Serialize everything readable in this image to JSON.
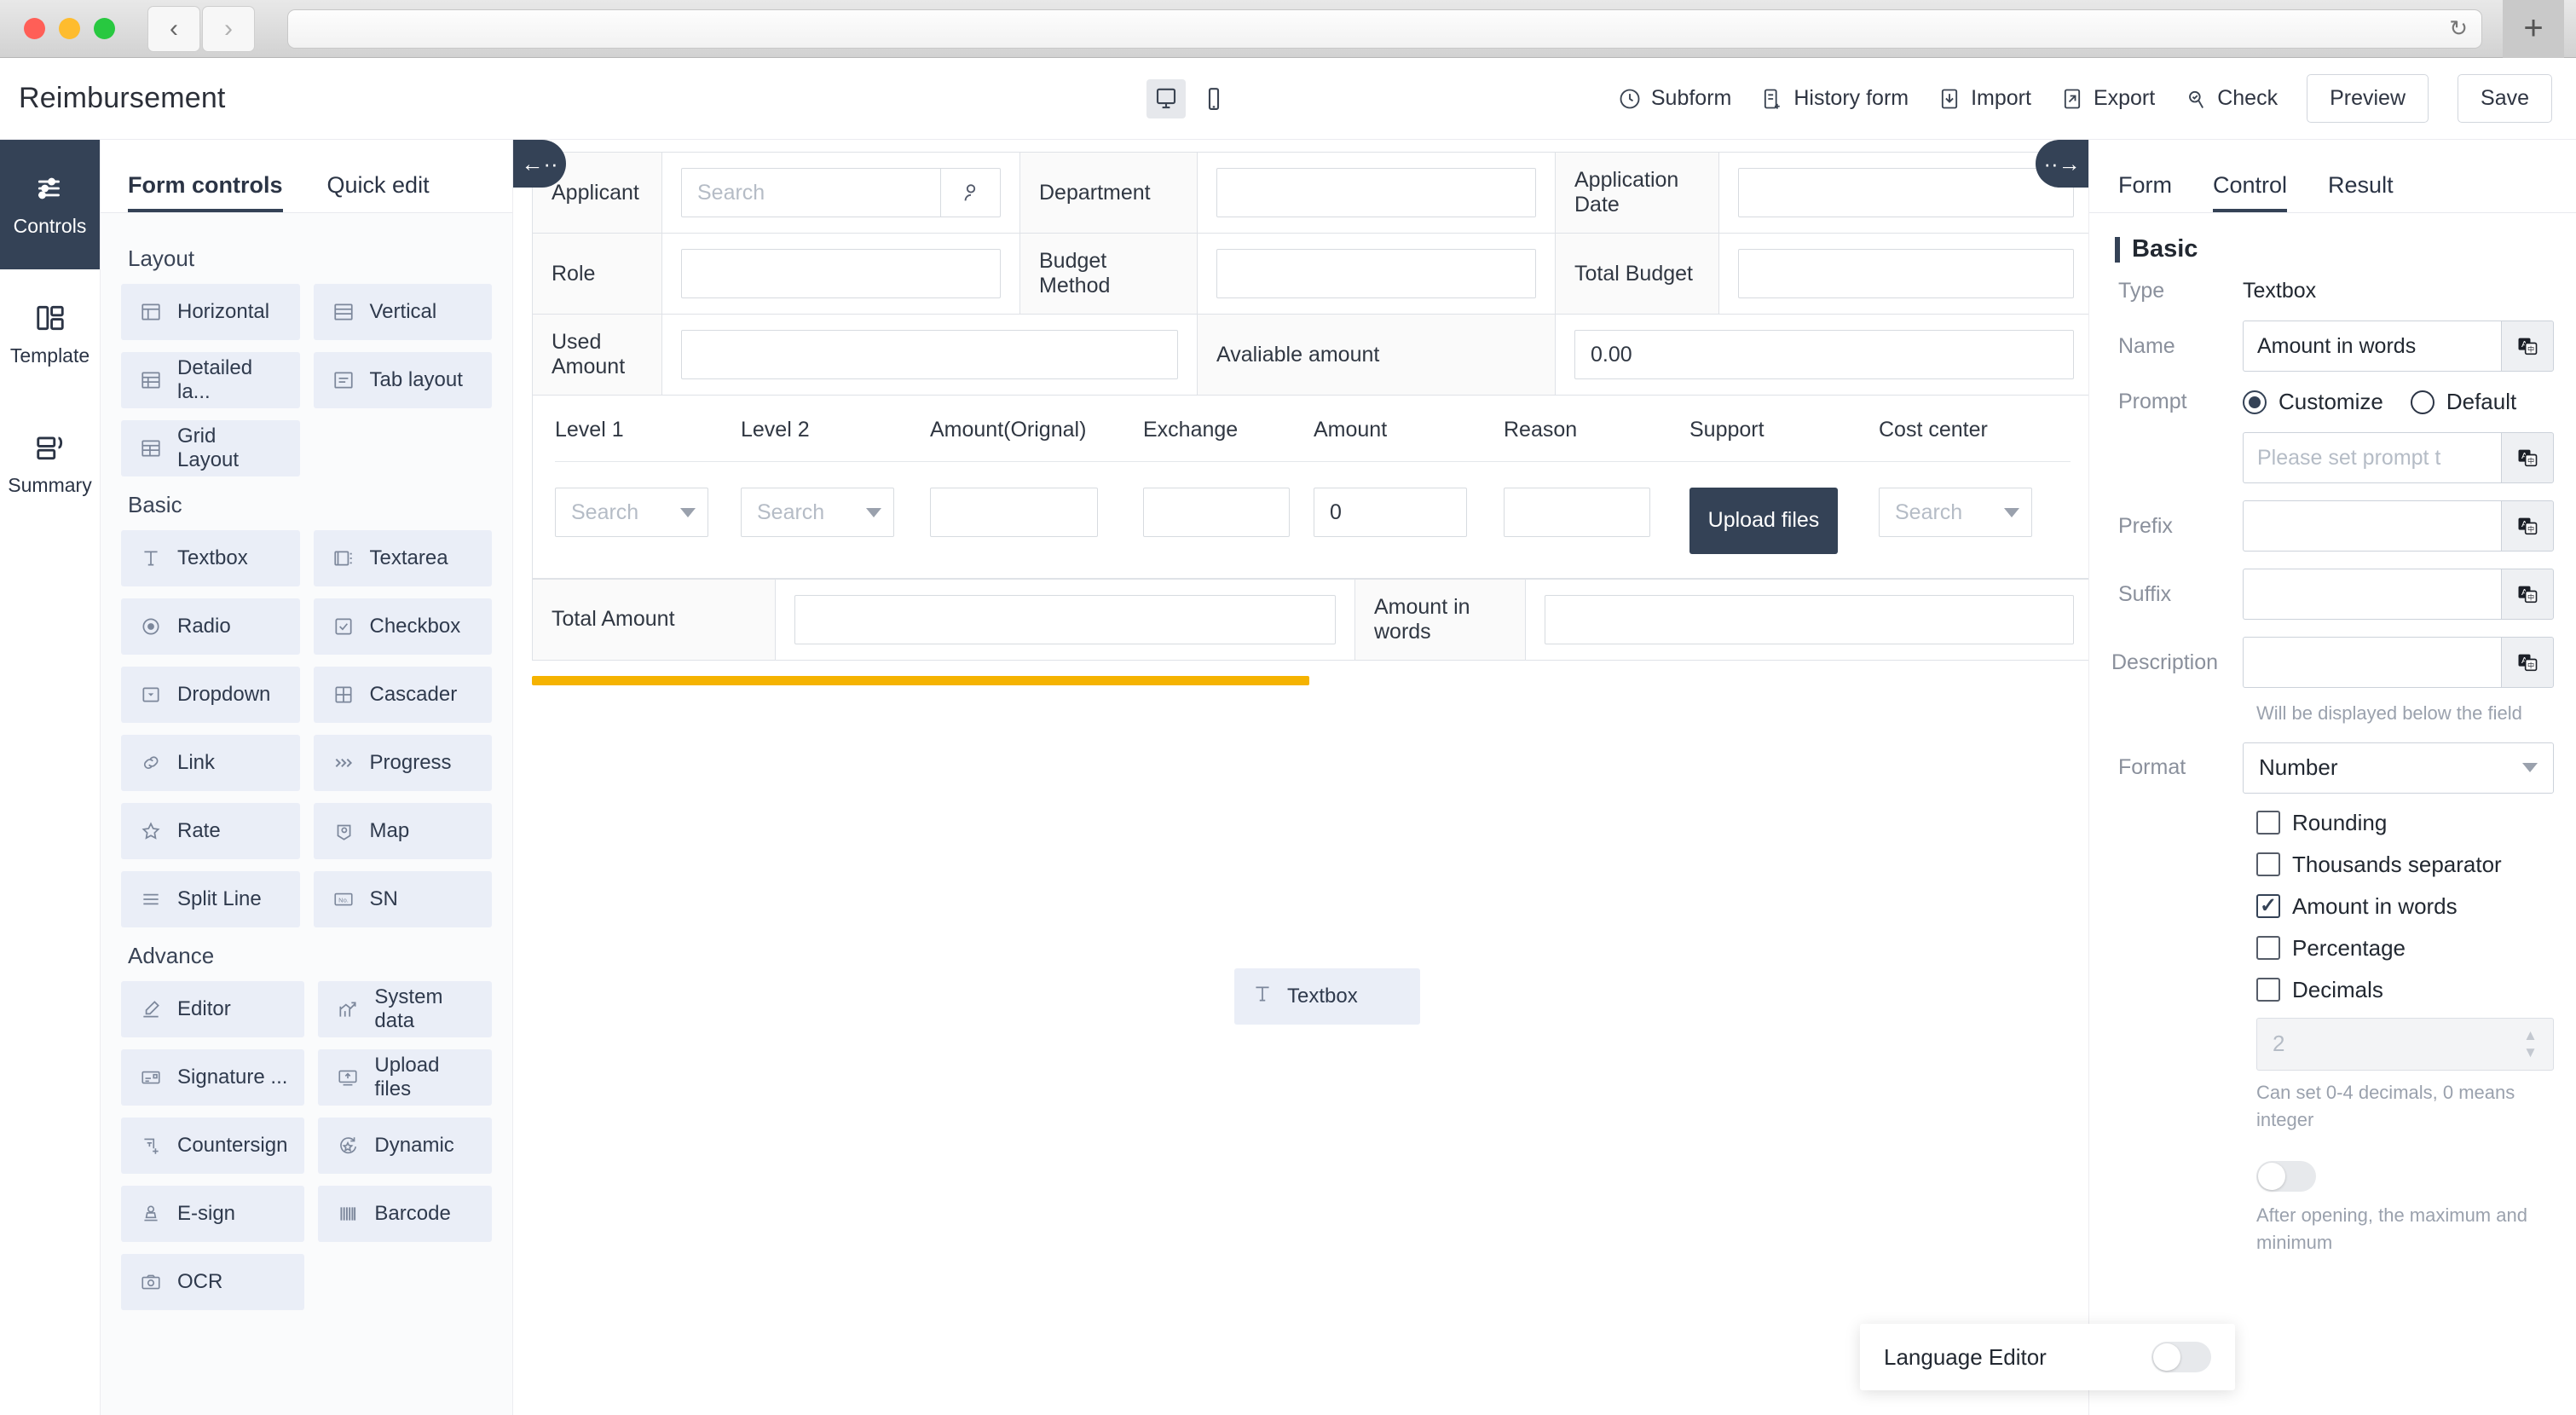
{
  "browser": {
    "back_icon": "chevron-left",
    "forward_icon": "chevron-right",
    "url_value": "",
    "reload_icon": "reload-icon",
    "newtab_label": "+"
  },
  "header": {
    "title": "Reimbursement",
    "device_desktop": "desktop-icon",
    "device_mobile": "mobile-icon",
    "actions": [
      {
        "label": "Subform",
        "icon": "clock-icon"
      },
      {
        "label": "History form",
        "icon": "history-form-icon"
      },
      {
        "label": "Import",
        "icon": "import-icon"
      },
      {
        "label": "Export",
        "icon": "export-icon"
      },
      {
        "label": "Check",
        "icon": "check-search-icon"
      }
    ],
    "preview_label": "Preview",
    "save_label": "Save"
  },
  "rail": {
    "items": [
      {
        "label": "Controls",
        "icon": "sliders-icon",
        "active": true
      },
      {
        "label": "Template",
        "icon": "template-icon",
        "active": false
      },
      {
        "label": "Summary",
        "icon": "summary-icon",
        "active": false
      }
    ]
  },
  "palette": {
    "tabs": [
      {
        "label": "Form controls",
        "active": true
      },
      {
        "label": "Quick edit",
        "active": false
      }
    ],
    "groups": [
      {
        "title": "Layout",
        "items": [
          {
            "label": "Horizontal",
            "icon": "layout-horizontal-icon"
          },
          {
            "label": "Vertical",
            "icon": "layout-vertical-icon"
          },
          {
            "label": "Detailed la...",
            "icon": "layout-detailed-icon"
          },
          {
            "label": "Tab layout",
            "icon": "layout-tab-icon"
          },
          {
            "label": "Grid Layout",
            "icon": "layout-grid-icon"
          }
        ]
      },
      {
        "title": "Basic",
        "items": [
          {
            "label": "Textbox",
            "icon": "textbox-icon"
          },
          {
            "label": "Textarea",
            "icon": "textarea-icon"
          },
          {
            "label": "Radio",
            "icon": "radio-icon"
          },
          {
            "label": "Checkbox",
            "icon": "checkbox-icon"
          },
          {
            "label": "Dropdown",
            "icon": "dropdown-icon"
          },
          {
            "label": "Cascader",
            "icon": "cascader-icon"
          },
          {
            "label": "Link",
            "icon": "link-icon"
          },
          {
            "label": "Progress",
            "icon": "progress-icon"
          },
          {
            "label": "Rate",
            "icon": "star-icon"
          },
          {
            "label": "Map",
            "icon": "map-pin-icon"
          },
          {
            "label": "Split Line",
            "icon": "split-line-icon"
          },
          {
            "label": "SN",
            "icon": "serial-number-icon"
          }
        ]
      },
      {
        "title": "Advance",
        "items": [
          {
            "label": "Editor",
            "icon": "editor-pen-icon"
          },
          {
            "label": "System data",
            "icon": "system-data-chart-icon"
          },
          {
            "label": "Signature ...",
            "icon": "signature-icon"
          },
          {
            "label": "Upload files",
            "icon": "upload-files-icon"
          },
          {
            "label": "Countersign",
            "icon": "countersign-icon"
          },
          {
            "label": "Dynamic",
            "icon": "dynamic-refresh-icon"
          },
          {
            "label": "E-sign",
            "icon": "e-sign-stamp-icon"
          },
          {
            "label": "Barcode",
            "icon": "barcode-icon"
          },
          {
            "label": "OCR",
            "icon": "ocr-camera-icon"
          }
        ]
      }
    ]
  },
  "canvas": {
    "collapse_left_icon": "arrow-left-collapse",
    "collapse_right_icon": "arrow-right-collapse",
    "rows": [
      {
        "cells": [
          {
            "label": "Applicant",
            "value": "",
            "placeholder": "Search",
            "kind": "person-search"
          },
          {
            "label": "Department",
            "value": "",
            "kind": "input"
          },
          {
            "label": "Application Date",
            "value": "",
            "kind": "input"
          }
        ]
      },
      {
        "cells": [
          {
            "label": "Role",
            "value": "",
            "kind": "input"
          },
          {
            "label": "Budget Method",
            "value": "",
            "kind": "input"
          },
          {
            "label": "Total Budget",
            "value": "",
            "kind": "input"
          }
        ]
      },
      {
        "cells": [
          {
            "label": "Used Amount",
            "value": "",
            "kind": "input"
          },
          {
            "label": "Avaliable amount",
            "value": "0.00",
            "kind": "input"
          }
        ]
      }
    ],
    "subform": {
      "columns": [
        "Level 1",
        "Level 2",
        "Amount(Orignal)",
        "Exchange",
        "Amount",
        "Reason",
        "Support",
        "Cost center"
      ],
      "row": {
        "level1": "Search",
        "level2": "Search",
        "amount_original": "",
        "exchange": "",
        "amount": "0",
        "reason": "",
        "support_button": "Upload files",
        "cost_center": "Search"
      }
    },
    "total_row": {
      "cells": [
        {
          "label": "Total Amount",
          "value": ""
        },
        {
          "label": "Amount in words",
          "value": ""
        }
      ]
    },
    "drop_indicator_color": "#f5b301",
    "drag_ghost": {
      "label": "Textbox",
      "icon": "textbox-icon"
    }
  },
  "props": {
    "tabs": [
      {
        "label": "Form",
        "active": false
      },
      {
        "label": "Control",
        "active": true
      },
      {
        "label": "Result",
        "active": false
      }
    ],
    "section_title": "Basic",
    "type_key": "Type",
    "type_value": "Textbox",
    "name_key": "Name",
    "name_value": "Amount in words",
    "prompt_key": "Prompt",
    "prompt_customize": "Customize",
    "prompt_default": "Default",
    "prompt_selected": "Customize",
    "prompt_placeholder": "Please set prompt t",
    "prefix_key": "Prefix",
    "prefix_value": "",
    "suffix_key": "Suffix",
    "suffix_value": "",
    "description_key": "Description",
    "description_value": "",
    "description_hint": "Will be displayed below the field",
    "format_key": "Format",
    "format_value": "Number",
    "i18n_icon": "translate-icon",
    "checkboxes": [
      {
        "label": "Rounding",
        "checked": false
      },
      {
        "label": "Thousands separator",
        "checked": false
      },
      {
        "label": "Amount in words",
        "checked": true
      },
      {
        "label": "Percentage",
        "checked": false
      },
      {
        "label": "Decimals",
        "checked": false
      }
    ],
    "decimals_value": "2",
    "decimals_hint": "Can set 0-4 decimals, 0 means integer",
    "after_toggle_hint": "After opening, the maximum and minimum"
  },
  "language_popup": {
    "label": "Language Editor",
    "toggle_on": false
  },
  "colors": {
    "accent": "#344256",
    "drop_indicator": "#f5b301",
    "palette_item_bg": "#eaeef7"
  }
}
